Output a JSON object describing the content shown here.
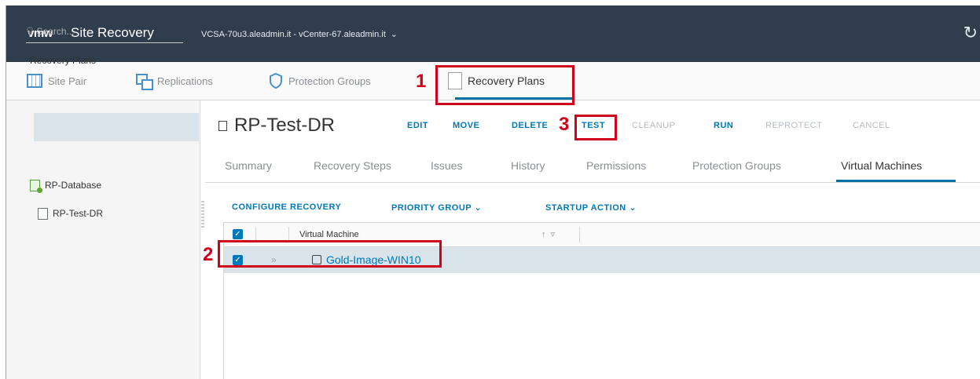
{
  "header": {
    "logo": "vmw",
    "app_title": "Site Recovery",
    "site_pair": "VCSA-70u3.aleadmin.it - vCenter-67.aleadmin.it"
  },
  "nav": {
    "items": [
      {
        "label": "Site Pair",
        "icon": "site-pair-icon"
      },
      {
        "label": "Replications",
        "icon": "replications-icon"
      },
      {
        "label": "Protection Groups",
        "icon": "shield-icon"
      },
      {
        "label": "Recovery Plans",
        "icon": "recovery-plan-icon"
      }
    ],
    "active": "Recovery Plans"
  },
  "annotations": {
    "n1": "1",
    "n2": "2",
    "n3": "3",
    "color": "#d0021b"
  },
  "sidebar": {
    "search_placeholder": "Search...",
    "heading": "Recovery Plans",
    "items": [
      {
        "label": "RP-Database",
        "icon": "recovery-plan-ok-icon"
      },
      {
        "label": "RP-Test-DR",
        "icon": "recovery-plan-icon",
        "selected": true
      }
    ]
  },
  "main": {
    "title": "RP-Test-DR",
    "actions": [
      {
        "label": "EDIT",
        "enabled": true
      },
      {
        "label": "MOVE",
        "enabled": true
      },
      {
        "label": "DELETE",
        "enabled": true
      },
      {
        "label": "TEST",
        "enabled": true
      },
      {
        "label": "CLEANUP",
        "enabled": false
      },
      {
        "label": "RUN",
        "enabled": true
      },
      {
        "label": "REPROTECT",
        "enabled": false
      },
      {
        "label": "CANCEL",
        "enabled": false
      }
    ],
    "tabs": [
      "Summary",
      "Recovery Steps",
      "Issues",
      "History",
      "Permissions",
      "Protection Groups",
      "Virtual Machines"
    ],
    "active_tab": "Virtual Machines",
    "vm_actions": [
      "CONFIGURE RECOVERY",
      "PRIORITY GROUP",
      "STARTUP ACTION"
    ],
    "grid": {
      "column": "Virtual Machine",
      "rows": [
        {
          "name": "Gold-Image-WIN10",
          "checked": true
        }
      ]
    }
  },
  "colors": {
    "header_bg": "#2f3d4c",
    "accent": "#0079b8",
    "selection": "#d9e4ea"
  }
}
